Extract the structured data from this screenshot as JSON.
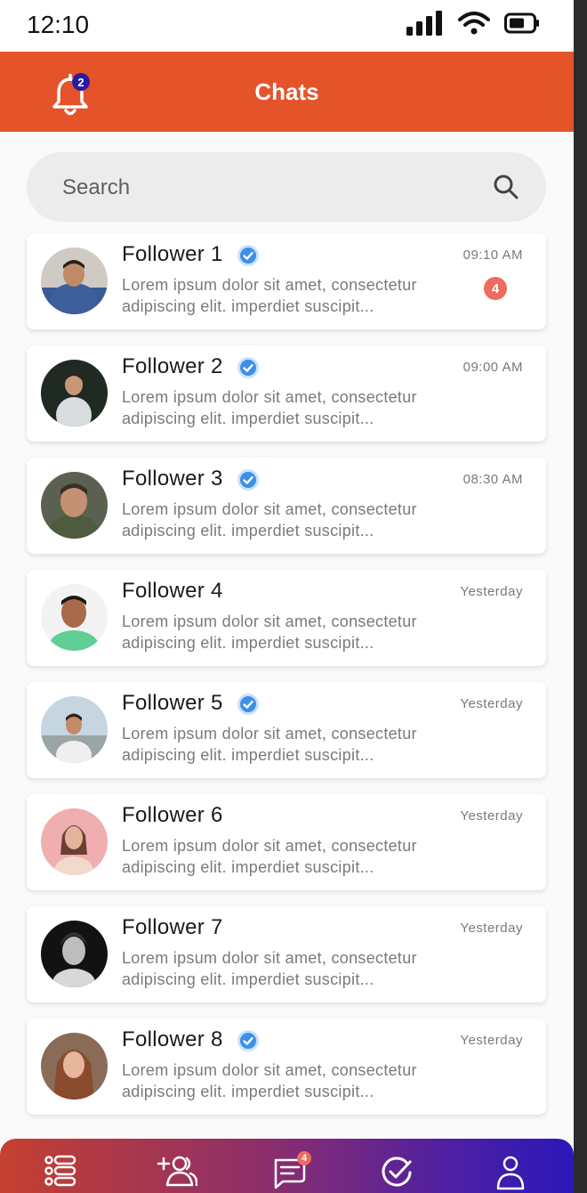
{
  "status_bar": {
    "time": "12:10"
  },
  "header": {
    "title": "Chats",
    "notification_count": "2"
  },
  "search": {
    "placeholder": "Search"
  },
  "chats": [
    {
      "name": "Follower 1",
      "verified": true,
      "message": "Lorem ipsum dolor sit amet, consectetur adipiscing elit. imperdiet suscipit...",
      "time": "09:10 AM",
      "unread": "4"
    },
    {
      "name": "Follower 2",
      "verified": true,
      "message": "Lorem ipsum dolor sit amet, consectetur adipiscing elit. imperdiet suscipit...",
      "time": "09:00 AM",
      "unread": ""
    },
    {
      "name": "Follower 3",
      "verified": true,
      "message": "Lorem ipsum dolor sit amet, consectetur adipiscing elit. imperdiet suscipit...",
      "time": "08:30 AM",
      "unread": ""
    },
    {
      "name": "Follower 4",
      "verified": false,
      "message": "Lorem ipsum dolor sit amet, consectetur adipiscing elit. imperdiet suscipit...",
      "time": "Yesterday",
      "unread": ""
    },
    {
      "name": "Follower 5",
      "verified": true,
      "message": "Lorem ipsum dolor sit amet, consectetur adipiscing elit. imperdiet suscipit...",
      "time": "Yesterday",
      "unread": ""
    },
    {
      "name": "Follower 6",
      "verified": false,
      "message": "Lorem ipsum dolor sit amet, consectetur adipiscing elit. imperdiet suscipit...",
      "time": "Yesterday",
      "unread": ""
    },
    {
      "name": "Follower 7",
      "verified": false,
      "message": "Lorem ipsum dolor sit amet, consectetur adipiscing elit. imperdiet suscipit...",
      "time": "Yesterday",
      "unread": ""
    },
    {
      "name": "Follower 8",
      "verified": true,
      "message": "Lorem ipsum dolor sit amet, consectetur adipiscing elit. imperdiet suscipit...",
      "time": "Yesterday",
      "unread": ""
    }
  ],
  "bottom_nav": {
    "items": [
      "list-icon",
      "add-group-icon",
      "chat-icon",
      "check-circle-icon",
      "profile-icon"
    ],
    "chat_badge": "4"
  },
  "colors": {
    "accent": "#e4532a",
    "verified": "#3d8fe8",
    "badge": "#ee6b5f",
    "nav_start": "#c5402f",
    "nav_end": "#2a18b7"
  }
}
